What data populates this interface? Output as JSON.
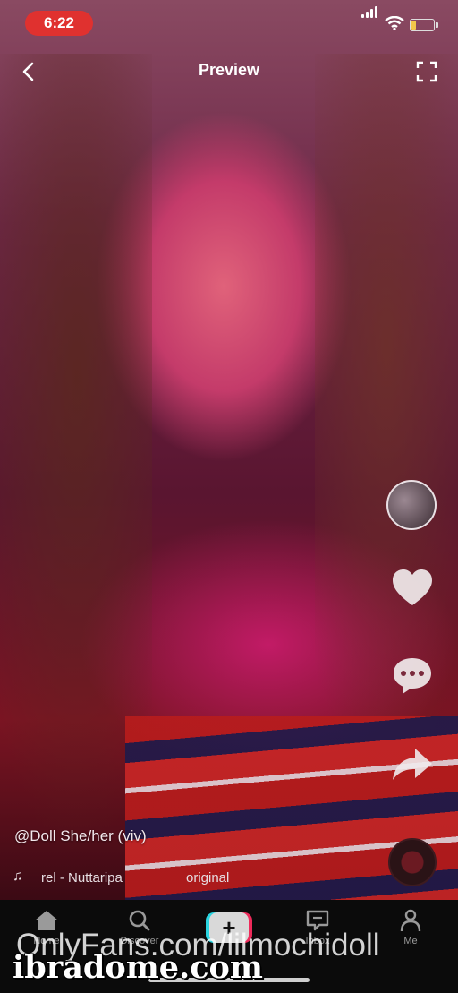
{
  "status_bar": {
    "time": "6:22"
  },
  "header": {
    "title": "Preview"
  },
  "video": {
    "caption": "@Doll She/her (viv)",
    "music_text": "rel - Nuttaripa",
    "music_source": "original"
  },
  "nav": {
    "home": "Home",
    "discover": "Discover",
    "inbox": "Inbox",
    "me": "Me",
    "create_symbol": "+"
  },
  "watermarks": {
    "line1": "OnlyFans.com/lilmochidoll",
    "line2": "ibradome.com"
  },
  "colors": {
    "time_pill": "#e0312f",
    "create_cyan": "#2ad4e0",
    "create_red": "#ee2a5a",
    "nav_bg": "#0b0b0b"
  },
  "icons": [
    "back-chevron-icon",
    "expand-icon",
    "heart-icon",
    "comment-icon",
    "share-icon",
    "music-note-icon",
    "home-icon",
    "search-icon",
    "inbox-icon",
    "person-icon"
  ]
}
